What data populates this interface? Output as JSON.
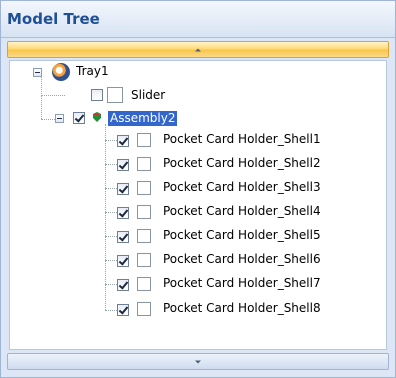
{
  "panel": {
    "title": "Model Tree"
  },
  "tree": {
    "root": {
      "label": "Tray1"
    },
    "slider": {
      "label": "Slider",
      "checked": false
    },
    "assembly": {
      "label": "Assembly2",
      "checked": true,
      "selected": true,
      "children": [
        {
          "label": "Pocket Card Holder_Shell1",
          "checked": true
        },
        {
          "label": "Pocket Card Holder_Shell2",
          "checked": true
        },
        {
          "label": "Pocket Card Holder_Shell3",
          "checked": true
        },
        {
          "label": "Pocket Card Holder_Shell4",
          "checked": true
        },
        {
          "label": "Pocket Card Holder_Shell5",
          "checked": true
        },
        {
          "label": "Pocket Card Holder_Shell6",
          "checked": true
        },
        {
          "label": "Pocket Card Holder_Shell7",
          "checked": true
        },
        {
          "label": "Pocket Card Holder_Shell8",
          "checked": true
        }
      ]
    }
  },
  "colors": {
    "title_text": "#1f4f95",
    "selection": "#3366cc",
    "scroll_highlight": "#f9c54a"
  },
  "icons": {
    "root": "tray-part-icon",
    "assembly": "assembly-icon",
    "expand": "collapse-minus-icon"
  }
}
